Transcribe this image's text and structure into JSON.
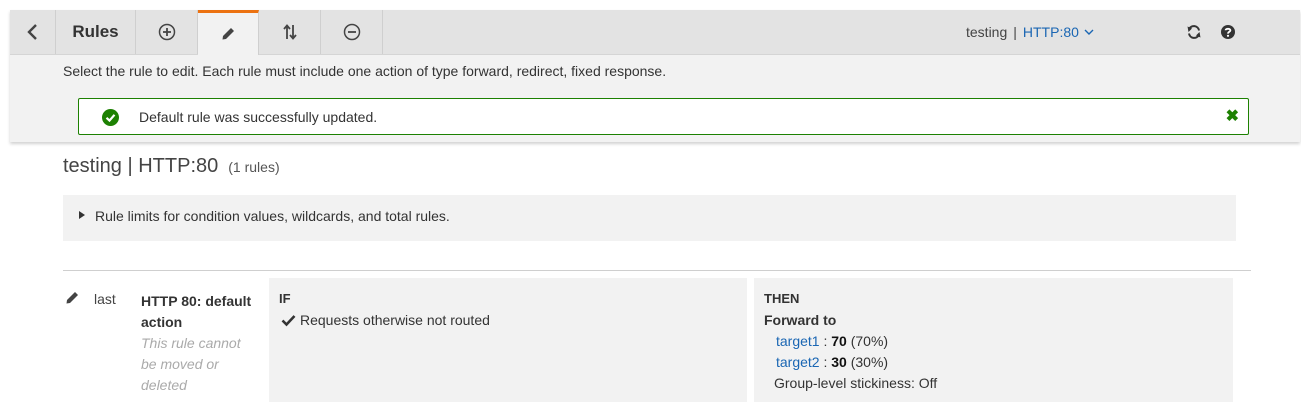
{
  "toolbar": {
    "title": "Rules",
    "listener_name": "testing",
    "listener_separator": "|",
    "listener_selected": "HTTP:80",
    "active_tab": "edit"
  },
  "instruction": "Select the rule to edit. Each rule must include one action of type forward, redirect, fixed response.",
  "alert": {
    "message": "Default rule was successfully updated.",
    "close_symbol": "✖"
  },
  "heading": {
    "title": "testing | HTTP:80",
    "count": "(1 rules)"
  },
  "limits": {
    "text": "Rule limits for condition values, wildcards, and total rules."
  },
  "rule": {
    "priority": "last",
    "name": "HTTP 80: default action",
    "note": "This rule cannot be moved or deleted",
    "if_label": "IF",
    "condition": "Requests otherwise not routed",
    "then_label": "THEN",
    "action": "Forward to",
    "targets": [
      {
        "name": "target1",
        "sep": " : ",
        "weight": "70",
        "pct": " (70%)"
      },
      {
        "name": "target2",
        "sep": " : ",
        "weight": "30",
        "pct": " (30%)"
      }
    ],
    "stickiness": "Group-level stickiness: Off"
  },
  "colors": {
    "accent_orange": "#ec7211",
    "success_green": "#1d8102",
    "link_blue": "#1a66b3"
  },
  "icons": [
    "back-icon",
    "add-icon",
    "pencil-icon",
    "reorder-icon",
    "remove-icon",
    "chevron-down-icon",
    "refresh-icon",
    "help-icon",
    "check-circle-icon",
    "close-icon",
    "caret-right-icon",
    "checkmark-icon"
  ]
}
